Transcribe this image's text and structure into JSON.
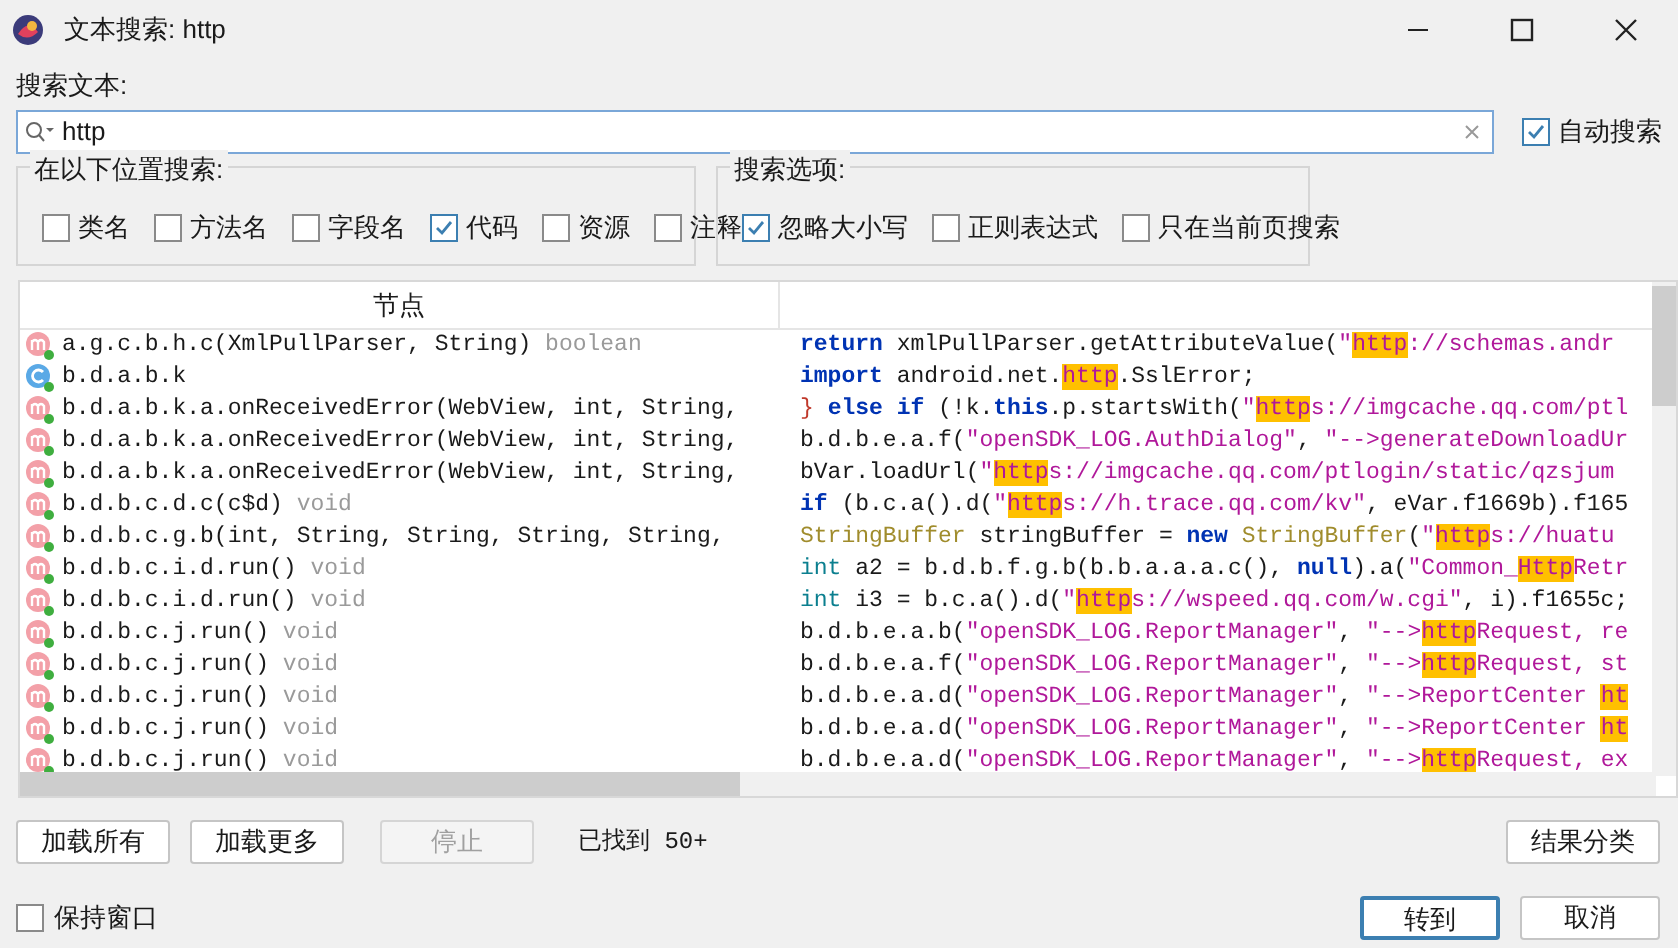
{
  "window": {
    "title": "文本搜索: http"
  },
  "search": {
    "label": "搜索文本:",
    "value": "http"
  },
  "auto_search": {
    "label": "自动搜索",
    "checked": true
  },
  "location_group": {
    "title": "在以下位置搜索:",
    "options": [
      {
        "label": "类名",
        "checked": false
      },
      {
        "label": "方法名",
        "checked": false
      },
      {
        "label": "字段名",
        "checked": false
      },
      {
        "label": "代码",
        "checked": true
      },
      {
        "label": "资源",
        "checked": false
      },
      {
        "label": "注释",
        "checked": false
      }
    ]
  },
  "options_group": {
    "title": "搜索选项:",
    "options": [
      {
        "label": "忽略大小写",
        "checked": true
      },
      {
        "label": "正则表达式",
        "checked": false
      },
      {
        "label": "只在当前页搜索",
        "checked": false
      }
    ]
  },
  "table": {
    "columns": [
      "节点"
    ],
    "rows": [
      {
        "node": {
          "kind": "method",
          "text": "a.g.c.b.h.c(XmlPullParser, String)",
          "type": "boolean"
        },
        "code": [
          {
            "kind": "kw",
            "text": "return"
          },
          {
            "kind": "plain",
            "text": " xmlPullParser.getAttributeValue("
          },
          {
            "kind": "str",
            "text": "\""
          },
          {
            "kind": "hit",
            "text": "http"
          },
          {
            "kind": "str",
            "text": "://schemas.andr"
          }
        ]
      },
      {
        "node": {
          "kind": "class",
          "text": "b.d.a.b.k"
        },
        "code": [
          {
            "kind": "kw",
            "text": "import"
          },
          {
            "kind": "plain",
            "text": " android.net."
          },
          {
            "kind": "hit",
            "text": "http"
          },
          {
            "kind": "plain",
            "text": ".SslError;"
          }
        ]
      },
      {
        "node": {
          "kind": "method",
          "text": "b.d.a.b.k.a.onReceivedError(WebView, int, String,"
        },
        "code": [
          {
            "kind": "punct",
            "text": "} "
          },
          {
            "kind": "kw",
            "text": "else if"
          },
          {
            "kind": "plain",
            "text": " (!k."
          },
          {
            "kind": "kw",
            "text": "this"
          },
          {
            "kind": "plain",
            "text": ".p.startsWith("
          },
          {
            "kind": "str",
            "text": "\""
          },
          {
            "kind": "hit",
            "text": "http"
          },
          {
            "kind": "str",
            "text": "s://imgcache.qq.com/ptl"
          }
        ]
      },
      {
        "node": {
          "kind": "method",
          "text": "b.d.a.b.k.a.onReceivedError(WebView, int, String,"
        },
        "code": [
          {
            "kind": "plain",
            "text": "b.d.b.e.a.f("
          },
          {
            "kind": "str",
            "text": "\"openSDK_LOG.AuthDialog\""
          },
          {
            "kind": "plain",
            "text": ", "
          },
          {
            "kind": "str",
            "text": "\"-->generateDownloadUr"
          }
        ]
      },
      {
        "node": {
          "kind": "method",
          "text": "b.d.a.b.k.a.onReceivedError(WebView, int, String,"
        },
        "code": [
          {
            "kind": "plain",
            "text": "bVar.loadUrl("
          },
          {
            "kind": "str",
            "text": "\""
          },
          {
            "kind": "hit",
            "text": "http"
          },
          {
            "kind": "str",
            "text": "s://imgcache.qq.com/ptlogin/static/qzsjum"
          }
        ]
      },
      {
        "node": {
          "kind": "method",
          "text": "b.d.b.c.d.c(c$d)",
          "type": "void"
        },
        "code": [
          {
            "kind": "kw",
            "text": "if"
          },
          {
            "kind": "plain",
            "text": " (b.c.a().d("
          },
          {
            "kind": "str",
            "text": "\""
          },
          {
            "kind": "hit",
            "text": "http"
          },
          {
            "kind": "str",
            "text": "s://h.trace.qq.com/kv\""
          },
          {
            "kind": "plain",
            "text": ", eVar.f1669b).f165"
          }
        ]
      },
      {
        "node": {
          "kind": "method",
          "text": "b.d.b.c.g.b(int, String, String, String, String,"
        },
        "code": [
          {
            "kind": "type",
            "text": "StringBuffer"
          },
          {
            "kind": "plain",
            "text": " stringBuffer = "
          },
          {
            "kind": "kw",
            "text": "new"
          },
          {
            "kind": "type",
            "text": " StringBuffer"
          },
          {
            "kind": "plain",
            "text": "("
          },
          {
            "kind": "str",
            "text": "\""
          },
          {
            "kind": "hit",
            "text": "http"
          },
          {
            "kind": "str",
            "text": "s://huatu"
          }
        ]
      },
      {
        "node": {
          "kind": "method",
          "text": "b.d.b.c.i.d.run()",
          "type": "void"
        },
        "code": [
          {
            "kind": "prim",
            "text": "int"
          },
          {
            "kind": "plain",
            "text": " a2 = b.d.b.f.g.b(b.b.a.a.a.c(), "
          },
          {
            "kind": "kw",
            "text": "null"
          },
          {
            "kind": "plain",
            "text": ").a("
          },
          {
            "kind": "str",
            "text": "\"Common_"
          },
          {
            "kind": "hit",
            "text": "Http"
          },
          {
            "kind": "str",
            "text": "Retr"
          }
        ]
      },
      {
        "node": {
          "kind": "method",
          "text": "b.d.b.c.i.d.run()",
          "type": "void"
        },
        "code": [
          {
            "kind": "prim",
            "text": "int"
          },
          {
            "kind": "plain",
            "text": " i3 = b.c.a().d("
          },
          {
            "kind": "str",
            "text": "\""
          },
          {
            "kind": "hit",
            "text": "http"
          },
          {
            "kind": "str",
            "text": "s://wspeed.qq.com/w.cgi\""
          },
          {
            "kind": "plain",
            "text": ", i).f1655c;"
          }
        ]
      },
      {
        "node": {
          "kind": "method",
          "text": "b.d.b.c.j.run()",
          "type": "void"
        },
        "code": [
          {
            "kind": "plain",
            "text": "b.d.b.e.a.b("
          },
          {
            "kind": "str",
            "text": "\"openSDK_LOG.ReportManager\""
          },
          {
            "kind": "plain",
            "text": ", "
          },
          {
            "kind": "str",
            "text": "\"-->"
          },
          {
            "kind": "hit",
            "text": "http"
          },
          {
            "kind": "str",
            "text": "Request, re"
          }
        ]
      },
      {
        "node": {
          "kind": "method",
          "text": "b.d.b.c.j.run()",
          "type": "void"
        },
        "code": [
          {
            "kind": "plain",
            "text": "b.d.b.e.a.f("
          },
          {
            "kind": "str",
            "text": "\"openSDK_LOG.ReportManager\""
          },
          {
            "kind": "plain",
            "text": ", "
          },
          {
            "kind": "str",
            "text": "\"-->"
          },
          {
            "kind": "hit",
            "text": "http"
          },
          {
            "kind": "str",
            "text": "Request, st"
          }
        ]
      },
      {
        "node": {
          "kind": "method",
          "text": "b.d.b.c.j.run()",
          "type": "void"
        },
        "code": [
          {
            "kind": "plain",
            "text": "b.d.b.e.a.d("
          },
          {
            "kind": "str",
            "text": "\"openSDK_LOG.ReportManager\""
          },
          {
            "kind": "plain",
            "text": ", "
          },
          {
            "kind": "str",
            "text": "\"-->ReportCenter "
          },
          {
            "kind": "hit",
            "text": "ht"
          }
        ]
      },
      {
        "node": {
          "kind": "method",
          "text": "b.d.b.c.j.run()",
          "type": "void"
        },
        "code": [
          {
            "kind": "plain",
            "text": "b.d.b.e.a.d("
          },
          {
            "kind": "str",
            "text": "\"openSDK_LOG.ReportManager\""
          },
          {
            "kind": "plain",
            "text": ", "
          },
          {
            "kind": "str",
            "text": "\"-->ReportCenter "
          },
          {
            "kind": "hit",
            "text": "ht"
          }
        ]
      },
      {
        "node": {
          "kind": "method",
          "text": "b.d.b.c.j.run()",
          "type": "void"
        },
        "code": [
          {
            "kind": "plain",
            "text": "b.d.b.e.a.d("
          },
          {
            "kind": "str",
            "text": "\"openSDK_LOG.ReportManager\""
          },
          {
            "kind": "plain",
            "text": ", "
          },
          {
            "kind": "str",
            "text": "\"-->"
          },
          {
            "kind": "hit",
            "text": "http"
          },
          {
            "kind": "str",
            "text": "Request, ex"
          }
        ]
      }
    ]
  },
  "actions": [
    {
      "label": "加载所有",
      "disabled": false
    },
    {
      "label": "加载更多",
      "disabled": false
    },
    {
      "label": "停止",
      "disabled": true
    }
  ],
  "found": "已找到 50+",
  "group_button": {
    "label": "结果分类"
  },
  "keep_window": {
    "label": "保持窗口",
    "checked": false
  },
  "dialog_buttons": [
    {
      "label": "转到",
      "default": true
    },
    {
      "label": "取消",
      "default": false
    }
  ]
}
